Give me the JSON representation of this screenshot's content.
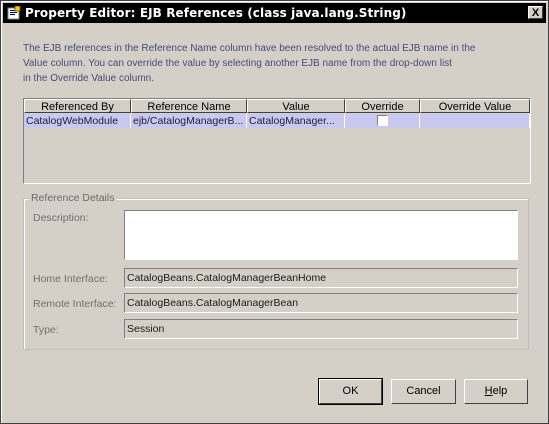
{
  "window": {
    "title": "Property Editor: EJB References (class java.lang.String)",
    "close_glyph": "X"
  },
  "description": {
    "line1": "The EJB references in the Reference Name column have been resolved to the actual EJB name in the",
    "line2": "Value column.  You can override the value by selecting another EJB name from the drop-down list",
    "line3": "in the Override Value column."
  },
  "table": {
    "headers": [
      "Referenced By",
      "Reference Name",
      "Value",
      "Override",
      "Override Value"
    ],
    "rows": [
      {
        "referenced_by": "CatalogWebModule",
        "reference_name": "ejb/CatalogManagerB...",
        "value": "CatalogManager...",
        "override": false,
        "override_value": ""
      }
    ]
  },
  "details": {
    "group_title": "Reference Details",
    "description_label": "Description:",
    "description_value": "",
    "home_label": "Home Interface:",
    "home_value": "CatalogBeans.CatalogManagerBeanHome",
    "remote_label": "Remote Interface:",
    "remote_value": "CatalogBeans.CatalogManagerBean",
    "type_label": "Type:",
    "type_value": "Session"
  },
  "buttons": {
    "ok": "OK",
    "cancel": "Cancel",
    "help_mnemonic": "H",
    "help_rest": "elp"
  },
  "icons": {
    "title_icon": "property-editor-icon",
    "close_icon": "close-icon"
  }
}
